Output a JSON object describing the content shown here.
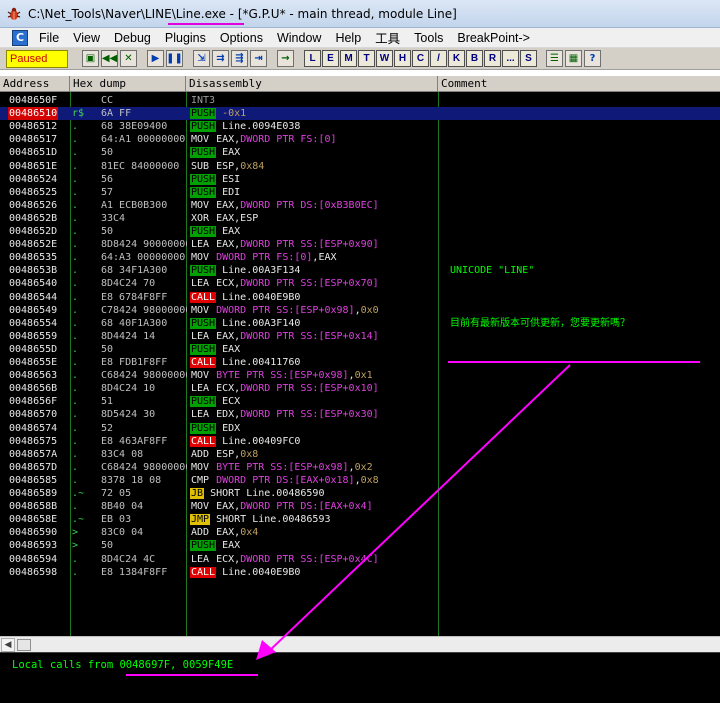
{
  "window": {
    "title": "C:\\Net_Tools\\Naver\\LINE\\Line.exe - [*G.P.U* - main thread, module Line]"
  },
  "menu": [
    "File",
    "View",
    "Debug",
    "Plugins",
    "Options",
    "Window",
    "Help",
    "工具",
    "Tools",
    "BreakPoint->"
  ],
  "toolbar": {
    "status": "Paused",
    "letter_buttons": [
      "L",
      "E",
      "M",
      "T",
      "W",
      "H",
      "C",
      "/",
      "K",
      "B",
      "R",
      "...",
      "S"
    ],
    "icons": [
      "open-icon",
      "rewind-icon",
      "close-icon",
      "run-icon",
      "pause-icon",
      "step-into-icon",
      "step-over-icon",
      "trace-into-icon",
      "trace-over-icon",
      "execute-till-return-icon",
      "goto-icon",
      "options-icon",
      "help-icon"
    ]
  },
  "columns": {
    "address": "Address",
    "hex": "Hex dump",
    "disasm": "Disassembly",
    "comment": "Comment"
  },
  "rows": [
    {
      "addr": "0048650F",
      "mark": "",
      "hex": "CC",
      "mn": "INT3",
      "kind": "int3",
      "op": "",
      "comment": ""
    },
    {
      "addr": "00486510",
      "mark": "r$",
      "hex": "6A FF",
      "mn": "PUSH",
      "kind": "push",
      "op": "-0x1",
      "comment": "",
      "selected": true,
      "eip": true
    },
    {
      "addr": "00486512",
      "mark": ".",
      "hex": "68 38E09400",
      "mn": "PUSH",
      "kind": "push",
      "op": "Line.0094E038",
      "comment": ""
    },
    {
      "addr": "00486517",
      "mark": ".",
      "hex": "64:A1 00000000",
      "mn": "MOV",
      "kind": "plain",
      "op": "EAX,DWORD PTR FS:[0]",
      "comment": ""
    },
    {
      "addr": "0048651D",
      "mark": ".",
      "hex": "50",
      "mn": "PUSH",
      "kind": "push",
      "op": "EAX",
      "comment": ""
    },
    {
      "addr": "0048651E",
      "mark": ".",
      "hex": "81EC 84000000",
      "mn": "SUB",
      "kind": "plain",
      "op": "ESP,0x84",
      "comment": ""
    },
    {
      "addr": "00486524",
      "mark": ".",
      "hex": "56",
      "mn": "PUSH",
      "kind": "push",
      "op": "ESI",
      "comment": ""
    },
    {
      "addr": "00486525",
      "mark": ".",
      "hex": "57",
      "mn": "PUSH",
      "kind": "push",
      "op": "EDI",
      "comment": ""
    },
    {
      "addr": "00486526",
      "mark": ".",
      "hex": "A1 ECB0B300",
      "mn": "MOV",
      "kind": "plain",
      "op": "EAX,DWORD PTR DS:[0xB3B0EC]",
      "comment": ""
    },
    {
      "addr": "0048652B",
      "mark": ".",
      "hex": "33C4",
      "mn": "XOR",
      "kind": "plain",
      "op": "EAX,ESP",
      "comment": ""
    },
    {
      "addr": "0048652D",
      "mark": ".",
      "hex": "50",
      "mn": "PUSH",
      "kind": "push",
      "op": "EAX",
      "comment": ""
    },
    {
      "addr": "0048652E",
      "mark": ".",
      "hex": "8D8424 90000000",
      "mn": "LEA",
      "kind": "plain",
      "op": "EAX,DWORD PTR SS:[ESP+0x90]",
      "comment": ""
    },
    {
      "addr": "00486535",
      "mark": ".",
      "hex": "64:A3 00000000",
      "mn": "MOV",
      "kind": "plain",
      "op": "DWORD PTR FS:[0],EAX",
      "comment": ""
    },
    {
      "addr": "0048653B",
      "mark": ".",
      "hex": "68 34F1A300",
      "mn": "PUSH",
      "kind": "push",
      "op": "Line.00A3F134",
      "comment": "UNICODE \"LINE\""
    },
    {
      "addr": "00486540",
      "mark": ".",
      "hex": "8D4C24 70",
      "mn": "LEA",
      "kind": "plain",
      "op": "ECX,DWORD PTR SS:[ESP+0x70]",
      "comment": ""
    },
    {
      "addr": "00486544",
      "mark": ".",
      "hex": "E8 6784F8FF",
      "mn": "CALL",
      "kind": "call",
      "op": "Line.0040E9B0",
      "comment": ""
    },
    {
      "addr": "00486549",
      "mark": ".",
      "hex": "C78424 98000000",
      "mn": "MOV",
      "kind": "plain",
      "op": "DWORD PTR SS:[ESP+0x98],0x0",
      "comment": ""
    },
    {
      "addr": "00486554",
      "mark": ".",
      "hex": "68 40F1A300",
      "mn": "PUSH",
      "kind": "push",
      "op": "Line.00A3F140",
      "comment": "目前有最新版本可供更新，您要更新嗎？"
    },
    {
      "addr": "00486559",
      "mark": ".",
      "hex": "8D4424 14",
      "mn": "LEA",
      "kind": "plain",
      "op": "EAX,DWORD PTR SS:[ESP+0x14]",
      "comment": ""
    },
    {
      "addr": "0048655D",
      "mark": ".",
      "hex": "50",
      "mn": "PUSH",
      "kind": "push",
      "op": "EAX",
      "comment": ""
    },
    {
      "addr": "0048655E",
      "mark": ".",
      "hex": "E8 FDB1F8FF",
      "mn": "CALL",
      "kind": "call",
      "op": "Line.00411760",
      "comment": ""
    },
    {
      "addr": "00486563",
      "mark": ".",
      "hex": "C68424 98000000",
      "mn": "MOV",
      "kind": "plain",
      "op": "BYTE PTR SS:[ESP+0x98],0x1",
      "comment": ""
    },
    {
      "addr": "0048656B",
      "mark": ".",
      "hex": "8D4C24 10",
      "mn": "LEA",
      "kind": "plain",
      "op": "ECX,DWORD PTR SS:[ESP+0x10]",
      "comment": ""
    },
    {
      "addr": "0048656F",
      "mark": ".",
      "hex": "51",
      "mn": "PUSH",
      "kind": "push",
      "op": "ECX",
      "comment": ""
    },
    {
      "addr": "00486570",
      "mark": ".",
      "hex": "8D5424 30",
      "mn": "LEA",
      "kind": "plain",
      "op": "EDX,DWORD PTR SS:[ESP+0x30]",
      "comment": ""
    },
    {
      "addr": "00486574",
      "mark": ".",
      "hex": "52",
      "mn": "PUSH",
      "kind": "push",
      "op": "EDX",
      "comment": ""
    },
    {
      "addr": "00486575",
      "mark": ".",
      "hex": "E8 463AF8FF",
      "mn": "CALL",
      "kind": "call",
      "op": "Line.00409FC0",
      "comment": ""
    },
    {
      "addr": "0048657A",
      "mark": ".",
      "hex": "83C4 08",
      "mn": "ADD",
      "kind": "plain",
      "op": "ESP,0x8",
      "comment": ""
    },
    {
      "addr": "0048657D",
      "mark": ".",
      "hex": "C68424 98000000",
      "mn": "MOV",
      "kind": "plain",
      "op": "BYTE PTR SS:[ESP+0x98],0x2",
      "comment": ""
    },
    {
      "addr": "00486585",
      "mark": ".",
      "hex": "8378 18 08",
      "mn": "CMP",
      "kind": "plain",
      "op": "DWORD PTR DS:[EAX+0x18],0x8",
      "comment": ""
    },
    {
      "addr": "00486589",
      "mark": ".~",
      "hex": "72 05",
      "mn": "JB",
      "kind": "jmp",
      "op": "SHORT Line.00486590",
      "comment": ""
    },
    {
      "addr": "0048658B",
      "mark": ".",
      "hex": "8B40 04",
      "mn": "MOV",
      "kind": "plain",
      "op": "EAX,DWORD PTR DS:[EAX+0x4]",
      "comment": ""
    },
    {
      "addr": "0048658E",
      "mark": ".~",
      "hex": "EB 03",
      "mn": "JMP",
      "kind": "jmp",
      "op": "SHORT Line.00486593",
      "comment": ""
    },
    {
      "addr": "00486590",
      "mark": ">",
      "hex": "83C0 04",
      "mn": "ADD",
      "kind": "plain",
      "op": "EAX,0x4",
      "comment": ""
    },
    {
      "addr": "00486593",
      "mark": ">",
      "hex": "50",
      "mn": "PUSH",
      "kind": "push",
      "op": "EAX",
      "comment": ""
    },
    {
      "addr": "00486594",
      "mark": ".",
      "hex": "8D4C24 4C",
      "mn": "LEA",
      "kind": "plain",
      "op": "ECX,DWORD PTR SS:[ESP+0x4C]",
      "comment": ""
    },
    {
      "addr": "00486598",
      "mark": ".",
      "hex": "E8 1384F8FF",
      "mn": "CALL",
      "kind": "call",
      "op": "Line.0040E9B0",
      "comment": ""
    }
  ],
  "info_pane": {
    "text": "Local calls from 0048697F, 0059F49E"
  },
  "colors": {
    "annotation": "#ff00ff",
    "code_bg": "#000000",
    "comment_text": "#00ff00",
    "selection": "#0f1a78"
  }
}
